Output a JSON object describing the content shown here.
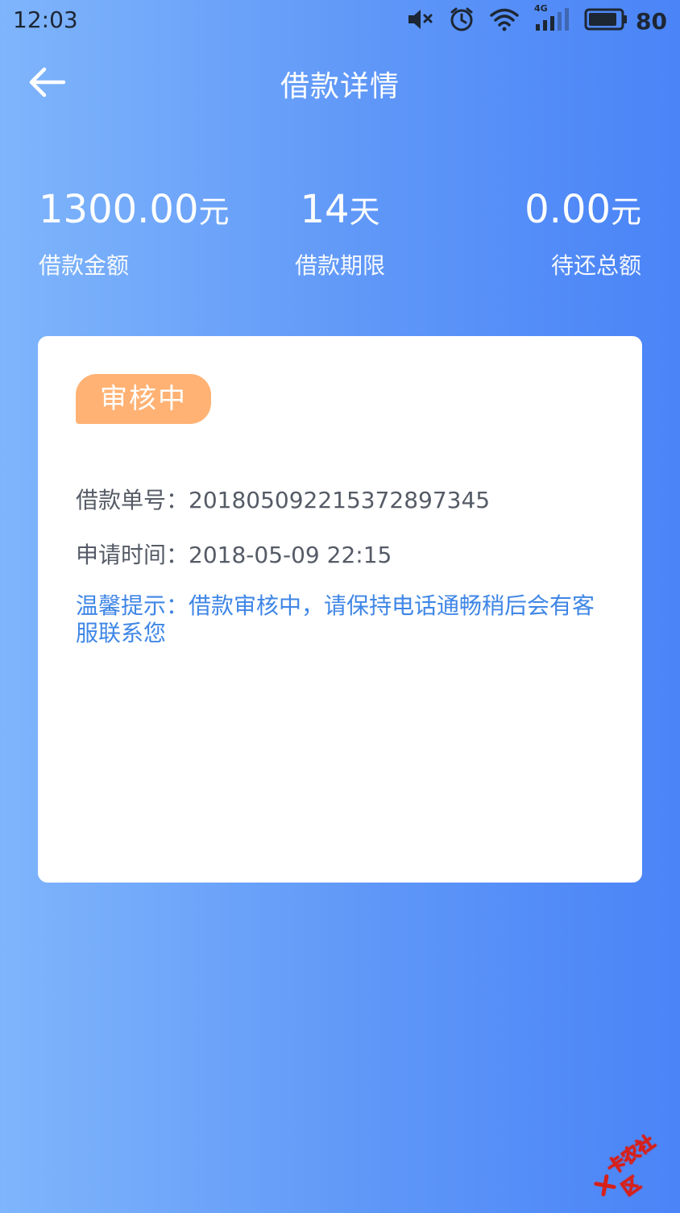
{
  "status_bar": {
    "time": "12:03",
    "network": "4G",
    "battery": "80",
    "icons": [
      "mute-icon",
      "alarm-icon",
      "wifi-icon",
      "signal-icon",
      "battery-icon"
    ]
  },
  "header": {
    "back_icon": "arrow-left-icon",
    "title": "借款详情"
  },
  "summary": {
    "amount_value": "1300.00",
    "amount_unit": "元",
    "amount_label": "借款金额",
    "term_value": "14",
    "term_unit": "天",
    "term_label": "借款期限",
    "due_value": "0.00",
    "due_unit": "元",
    "due_label": "待还总额"
  },
  "card": {
    "status_badge": "审核中",
    "order_label": "借款单号：",
    "order_value": "20180509221537289734​5",
    "time_label": "申请时间：",
    "time_value": "2018-05-09 22:15",
    "tip": "温馨提示：借款审核中，请保持电话通畅稍后会有客服联系您"
  },
  "watermark": {
    "text": "卡农社区"
  },
  "colors": {
    "gradient_start": "#7fb5fb",
    "gradient_end": "#4a84f7",
    "badge": "#ffb274",
    "tip_text": "#3f86e6",
    "watermark": "#d6201a"
  }
}
